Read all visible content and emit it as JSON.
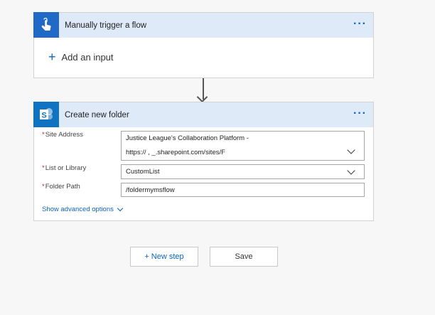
{
  "trigger": {
    "title": "Manually trigger a flow",
    "icon": "touch-hand-icon",
    "more": "···",
    "add_input_plus": "+",
    "add_input_label": "Add an input"
  },
  "action": {
    "title": "Create new folder",
    "icon": "sharepoint-icon",
    "icon_letter": "S",
    "more": "···",
    "fields": {
      "site_address": {
        "label": "Site Address",
        "value_line1": "Justice League's Collaboration Platform -",
        "value_line2": "https://  ,     _.sharepoint.com/sites/F"
      },
      "list_or_library": {
        "label": "List or Library",
        "value": "CustomList"
      },
      "folder_path": {
        "label": "Folder Path",
        "value": "/foldermymsflow"
      }
    },
    "required_marker": "*",
    "advanced_link": "Show advanced options"
  },
  "buttons": {
    "new_step": "+ New step",
    "save": "Save"
  },
  "colors": {
    "accent": "#0c64c0",
    "trigger_icon_bg": "#1e6ac6",
    "header_bg": "#deeaf7",
    "required": "#c4262e"
  }
}
